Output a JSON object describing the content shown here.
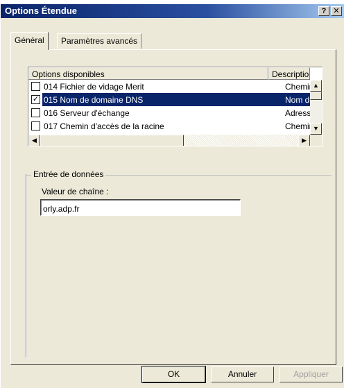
{
  "window": {
    "title": "Options Étendue",
    "help_button": "?",
    "close_button": "✕"
  },
  "tabs": [
    {
      "label": "Général",
      "active": true
    },
    {
      "label": "Paramètres avancés",
      "active": false
    }
  ],
  "list": {
    "columns": [
      "Options disponibles",
      "Description"
    ],
    "rows": [
      {
        "checked": false,
        "name": "014 Fichier de vidage Merit",
        "description": "Chemin du"
      },
      {
        "checked": true,
        "name": "015 Nom de domaine DNS",
        "description": "Nom de do",
        "selected": true
      },
      {
        "checked": false,
        "name": "016 Serveur d'échange",
        "description": "Adresse du"
      },
      {
        "checked": false,
        "name": "017 Chemin d'accès de la racine",
        "description": "Chemin du"
      }
    ]
  },
  "data_entry": {
    "group_label": "Entrée de données",
    "field_label": "Valeur de chaîne :",
    "field_value": "orly.adp.fr"
  },
  "buttons": {
    "ok": "OK",
    "cancel": "Annuler",
    "apply": "Appliquer"
  },
  "colors": {
    "selection": "#0a246a",
    "dialog_bg": "#ece9d8"
  }
}
